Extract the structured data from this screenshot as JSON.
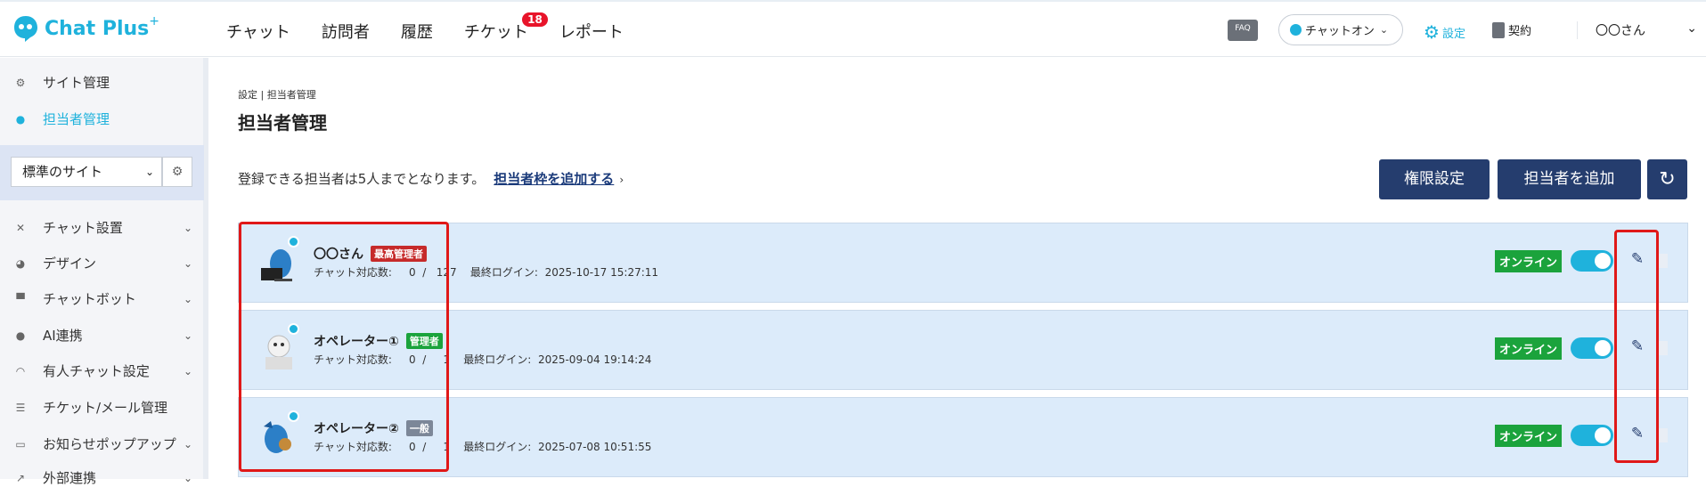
{
  "brand": {
    "name": "Chat Plus",
    "plus": "+"
  },
  "nav": [
    {
      "label": "チャット"
    },
    {
      "label": "訪問者"
    },
    {
      "label": "履歴"
    },
    {
      "label": "チケット",
      "badge": "18"
    },
    {
      "label": "レポート"
    }
  ],
  "topbar": {
    "faq": "FAQ",
    "chat_status": "チャットオン",
    "settings": "設定",
    "contract": "契約",
    "user": "〇〇さん"
  },
  "sidebar": {
    "site_admin": "サイト管理",
    "staff_admin": "担当者管理",
    "site_select": "標準のサイト",
    "items": [
      {
        "label": "チャット設置"
      },
      {
        "label": "デザイン"
      },
      {
        "label": "チャットボット"
      },
      {
        "label": "AI連携"
      },
      {
        "label": "有人チャット設定"
      },
      {
        "label": "チケット/メール管理"
      },
      {
        "label": "お知らせポップアップ"
      },
      {
        "label": "外部連携"
      }
    ]
  },
  "main": {
    "breadcrumb": "設定 | 担当者管理",
    "title": "担当者管理",
    "note": "登録できる担当者は5人までとなります。",
    "note_link": "担当者枠を追加する",
    "btn_role": "権限設定",
    "btn_add": "担当者を追加",
    "btn_refresh": "↻"
  },
  "staff": [
    {
      "name": "〇〇さん",
      "role": "最高管理者",
      "role_color": "#c62a2a",
      "stats": "チャット対応数:     0  /   127    最終ログイン:  2025-10-17 15:27:11",
      "status": "オンライン"
    },
    {
      "name": "オペレーター①",
      "role": "管理者",
      "role_color": "#1ba33c",
      "stats": "チャット対応数:     0  /     1    最終ログイン:  2025-09-04 19:14:24",
      "status": "オンライン"
    },
    {
      "name": "オペレーター②",
      "role": "一般",
      "role_color": "#7c8798",
      "stats": "チャット対応数:     0  /     1    最終ログイン:  2025-07-08 10:51:55",
      "status": "オンライン"
    }
  ],
  "colors": {
    "accent": "#1fb2dc",
    "primary": "#253d6e",
    "online": "#1ba33c",
    "highlight": "#e01818"
  }
}
